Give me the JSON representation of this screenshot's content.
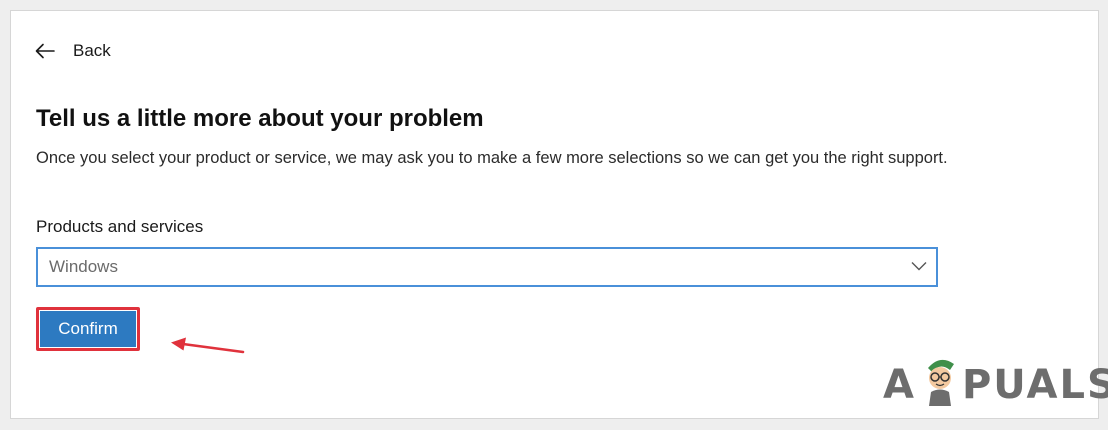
{
  "nav": {
    "back_label": "Back"
  },
  "main": {
    "title": "Tell us a little more about your problem",
    "description": "Once you select your product or service, we may ask you to make a few more selections so we can get you the right support.",
    "products_label": "Products and services",
    "products_selected": "Windows",
    "confirm_label": "Confirm"
  },
  "watermark": {
    "text_left": "A",
    "text_right": "PUALS"
  },
  "icons": {
    "back": "arrow-left-icon",
    "dropdown": "chevron-down-icon",
    "annotation": "red-arrow-icon"
  },
  "colors": {
    "accent_blue": "#2d7ac1",
    "focus_border": "#4a90d9",
    "highlight_red": "#e0323c"
  }
}
